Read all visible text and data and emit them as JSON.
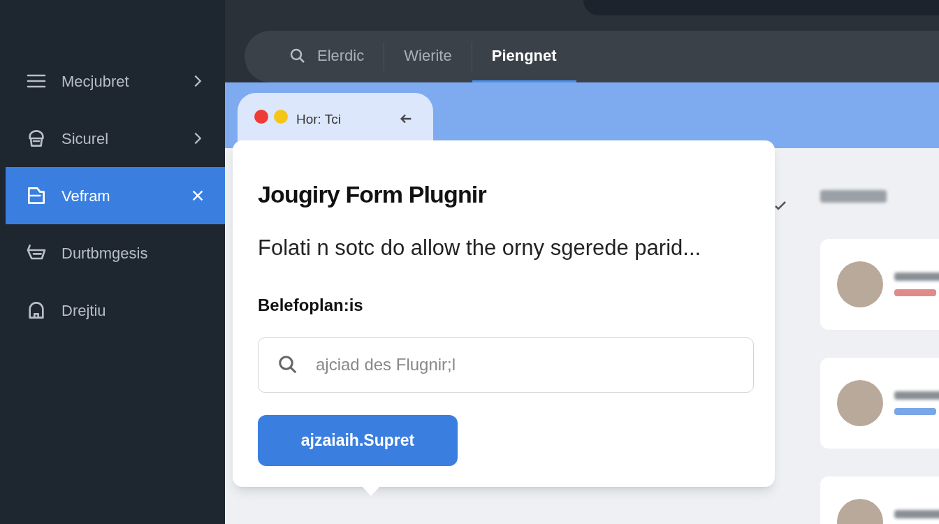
{
  "sidebar": {
    "items": [
      {
        "label": "Mecjubret",
        "kind": "expandable",
        "selected": false
      },
      {
        "label": "Sicurel",
        "kind": "expandable",
        "selected": false
      },
      {
        "label": "Vefram",
        "kind": "closable",
        "selected": true
      },
      {
        "label": "Durtbmgesis",
        "kind": "plain",
        "selected": false
      },
      {
        "label": "Drejtiu",
        "kind": "plain",
        "selected": false
      }
    ]
  },
  "nav": {
    "tabs": [
      {
        "label": "Elerdic",
        "selected": false
      },
      {
        "label": "Wierite",
        "selected": false
      },
      {
        "label": "Piengnet",
        "selected": true
      }
    ]
  },
  "window_tab": {
    "title": "Hor: Tci",
    "dots": [
      {
        "color": "#ef3b36"
      },
      {
        "color": "#f5c518"
      }
    ]
  },
  "dialog": {
    "title": "Jougiry Form Plugnir",
    "description": "Folati n sotc do allow the orny sgerede parid...",
    "field_label": "Belefoplan:is",
    "search": {
      "placeholder": "ajciad des Flugnir;l"
    },
    "button": "ajzaiaih.Supret"
  },
  "people_cards": [
    {
      "color": "#e08a8a"
    },
    {
      "color": "#7aa6e8"
    }
  ]
}
